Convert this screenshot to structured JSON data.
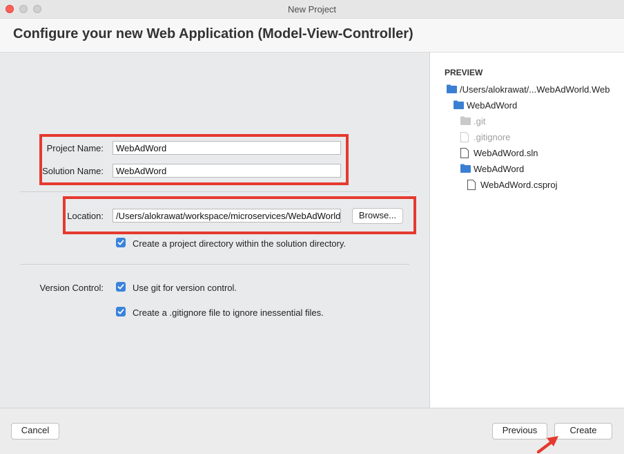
{
  "window": {
    "title": "New Project"
  },
  "header": {
    "title": "Configure your new Web Application (Model-View-Controller)"
  },
  "form": {
    "project_name": {
      "label": "Project Name:",
      "value": "WebAdWord"
    },
    "solution_name": {
      "label": "Solution Name:",
      "value": "WebAdWord"
    },
    "location": {
      "label": "Location:",
      "value": "/Users/alokrawat/workspace/microservices/WebAdWorld."
    },
    "browse_label": "Browse...",
    "create_dir": {
      "label": "Create a project directory within the solution directory.",
      "checked": true
    },
    "version_control": {
      "label": "Version Control:",
      "use_git": {
        "label": "Use git for version control.",
        "checked": true
      },
      "gitignore": {
        "label": "Create a .gitignore file to ignore inessential files.",
        "checked": true
      }
    }
  },
  "preview": {
    "title": "PREVIEW",
    "items": [
      {
        "text": "/Users/alokrawat/...WebAdWorld.Web",
        "icon": "folder-icon"
      },
      {
        "text": "WebAdWord",
        "icon": "folder-icon"
      },
      {
        "text": ".git",
        "icon": "folder-icon",
        "muted": true
      },
      {
        "text": ".gitignore",
        "icon": "file-icon",
        "muted": true
      },
      {
        "text": "WebAdWord.sln",
        "icon": "file-icon"
      },
      {
        "text": "WebAdWord",
        "icon": "folder-icon"
      },
      {
        "text": "WebAdWord.csproj",
        "icon": "file-icon"
      }
    ]
  },
  "footer": {
    "cancel_label": "Cancel",
    "previous_label": "Previous",
    "create_label": "Create"
  },
  "colors": {
    "highlight": "#e53a2f",
    "checkbox": "#3a83db",
    "folder": "#3b7fd2"
  }
}
